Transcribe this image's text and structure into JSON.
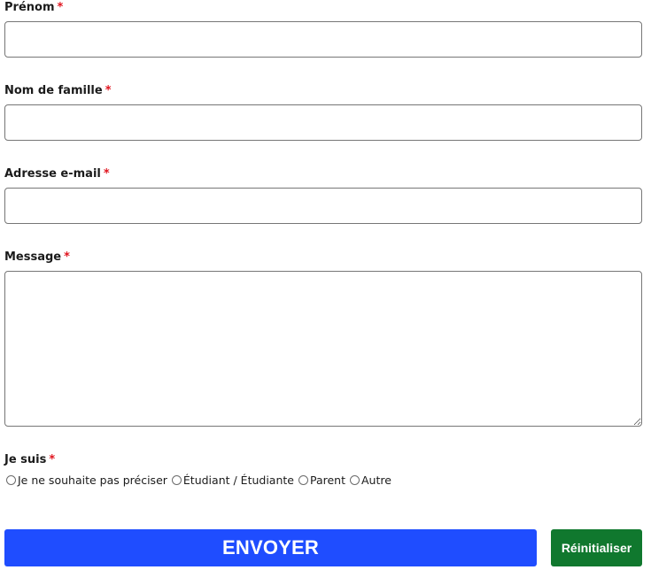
{
  "fields": {
    "first_name": {
      "label": "Prénom",
      "required_mark": "*",
      "value": "",
      "placeholder": ""
    },
    "last_name": {
      "label": "Nom de famille",
      "required_mark": "*",
      "value": "",
      "placeholder": ""
    },
    "email": {
      "label": "Adresse e-mail",
      "required_mark": "*",
      "value": "",
      "placeholder": ""
    },
    "message": {
      "label": "Message",
      "required_mark": "*",
      "value": "",
      "placeholder": ""
    }
  },
  "identity": {
    "label": "Je suis",
    "required_mark": "*",
    "options": [
      "Je ne souhaite pas préciser",
      "Étudiant / Étudiante",
      "Parent",
      "Autre"
    ]
  },
  "buttons": {
    "submit_label": "ENVOYER",
    "reset_label": "Réinitialiser"
  },
  "colors": {
    "required": "#e0141e",
    "submit_bg": "#1f4dff",
    "reset_bg": "#10782e",
    "border": "#767676"
  }
}
